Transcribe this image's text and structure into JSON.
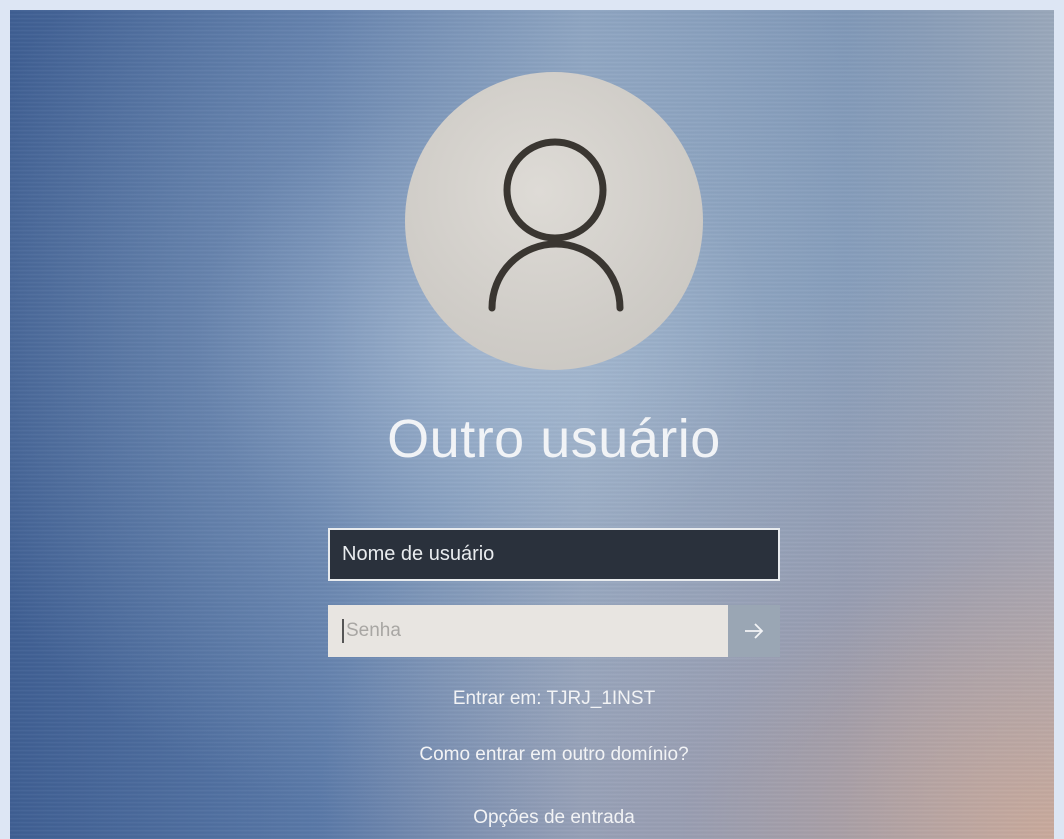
{
  "login": {
    "user_title": "Outro usuário",
    "username_value": "Nome de usuário",
    "password_placeholder": "Senha",
    "submit_icon": "arrow-right-icon",
    "domain_text": "Entrar em: TJRJ_1INST",
    "other_domain_link": "Como entrar em outro domínio?",
    "sign_in_options": "Opções de entrada"
  },
  "colors": {
    "background_blue": "#4a6b9c",
    "username_field_bg": "#2a313c",
    "password_field_bg": "#e8e5e1",
    "submit_button_bg": "#9aa6b4",
    "avatar_bg": "#d4d1cc",
    "text": "#f2f3f5"
  }
}
